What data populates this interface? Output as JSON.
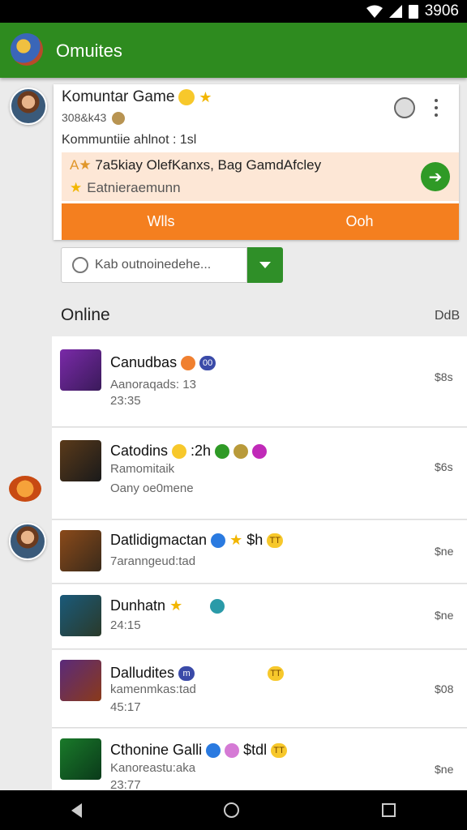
{
  "status": {
    "time": "3906"
  },
  "app": {
    "title": "Omuites"
  },
  "card": {
    "title": "Komuntar Game",
    "sub": "308&k43",
    "line": "Kommuntiie ahlnot : 1sl",
    "promo_text": "7a5kiay OlefKanxs, Bag GamdAfcley",
    "promo_sub": "Eatnieraemunn",
    "actions": [
      "Wlls",
      "Ooh"
    ]
  },
  "search": {
    "value": "Kab outnoinedehe..."
  },
  "section": {
    "title": "Online",
    "right": "DdB"
  },
  "list": [
    {
      "title": "Canudbas",
      "line1": "Aanoraqads: 13",
      "line2": "23:35",
      "price": "$8s",
      "icon_color": "#7a2aa8"
    },
    {
      "title": "Catodins",
      "title_extra": ":2h",
      "line1": "Ramomitaik",
      "line2": "Oany oe0mene",
      "price": "$6s",
      "icon_color": "#3a2a1a"
    },
    {
      "title": "Datlidigmactan",
      "title_extra": "$h",
      "line1": "7aranngeud:tad",
      "line2": "",
      "price": "$ne",
      "icon_color": "#8a4a1a"
    },
    {
      "title": "Dunhatn",
      "line1": "24:15",
      "line2": "",
      "price": "$ne",
      "icon_color": "#1a5a7a"
    },
    {
      "title": "Dalludites",
      "line1": "kamenmkas:tad",
      "line2": "45:17",
      "price": "$08",
      "icon_color": "#5a2a7a"
    },
    {
      "title": "Cthonine Galli",
      "title_extra": "$tdl",
      "line1": "Kanoreastu:aka",
      "line2": "23:77",
      "price": "$ne",
      "icon_color": "#1a7a2a"
    }
  ]
}
